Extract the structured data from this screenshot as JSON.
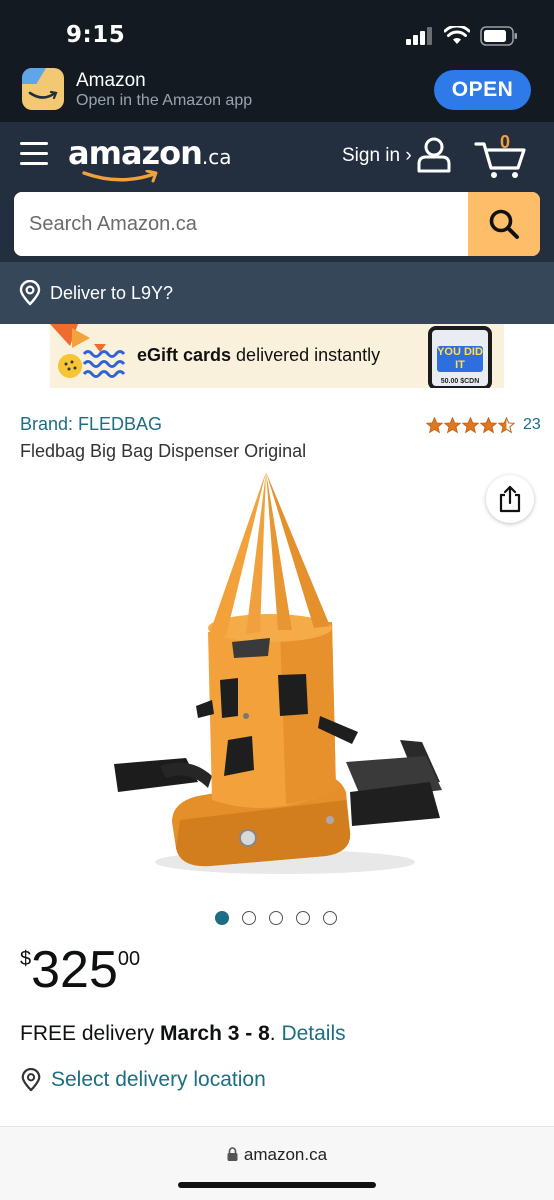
{
  "status_bar": {
    "time": "9:15"
  },
  "app_banner": {
    "app_name": "Amazon",
    "subtitle": "Open in the Amazon app",
    "open_label": "OPEN"
  },
  "header": {
    "logo_text": "amazon",
    "logo_suffix": ".ca",
    "signin_label": "Sign in ›",
    "cart_count": "0",
    "search_placeholder": "Search Amazon.ca"
  },
  "deliver_bar": {
    "label": "Deliver to L9Y?"
  },
  "promo_banner": {
    "text_bold": "eGift cards",
    "text_rest": " delivered instantly",
    "card_text": "YOU DID IT",
    "card_amount": "50.00 $CDN"
  },
  "product": {
    "brand": "Brand: FLEDBAG",
    "rating_stars": 4.5,
    "rating_count": "23",
    "title": "Fledbag Big Bag Dispenser Original",
    "image_count": 5,
    "active_image": 1,
    "price_symbol": "$",
    "price_whole": "325",
    "price_fraction": "00",
    "delivery_prefix": "FREE delivery ",
    "delivery_dates": "March 3 - 8",
    "delivery_period": ". ",
    "details_link": "Details",
    "select_location": "Select delivery location"
  },
  "browser": {
    "url": "amazon.ca"
  },
  "colors": {
    "header_dark": "#232f3e",
    "deliver_bar": "#37475a",
    "search_button": "#febd69",
    "link": "#1d6d84",
    "product_orange": "#f0a03c",
    "open_button": "#2d7ae8"
  }
}
